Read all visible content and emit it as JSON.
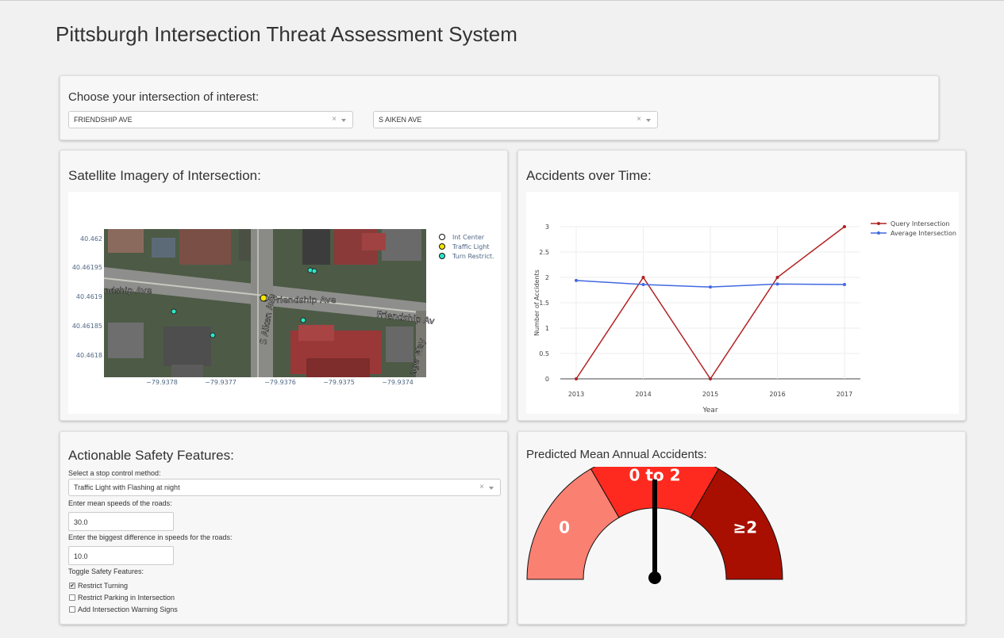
{
  "app": {
    "title": "Pittsburgh Intersection Threat Assessment System"
  },
  "chooser": {
    "title": "Choose your intersection of interest:",
    "street1": "FRIENDSHIP AVE",
    "street2": "S AIKEN AVE",
    "clear_glyph": "×"
  },
  "satellite": {
    "title": "Satellite Imagery of Intersection:",
    "y_ticks": [
      "40.462",
      "40.46195",
      "40.4619",
      "40.46185",
      "40.4618"
    ],
    "x_ticks": [
      "−79.9378",
      "−79.9377",
      "−79.9376",
      "−79.9375",
      "−79.9374"
    ],
    "legend": [
      {
        "label": "Int Center",
        "color": "#ffffff"
      },
      {
        "label": "Traffic Light",
        "color": "#f2e600"
      },
      {
        "label": "Turn Restrict.",
        "color": "#2ee6c8"
      }
    ],
    "street_labels": [
      "ndship Ave",
      "Friendship Ave",
      "S Aiken Ave",
      "Friendship Av",
      "age Way"
    ]
  },
  "accidents": {
    "title": "Accidents over Time:",
    "chart_data": {
      "type": "line",
      "x": [
        2013,
        2014,
        2015,
        2016,
        2017
      ],
      "xlabel": "Year",
      "ylabel": "Number of Accidents",
      "ylim": [
        0,
        3
      ],
      "yticks": [
        "0",
        "0.5",
        "1",
        "1.5",
        "2",
        "2.5",
        "3"
      ],
      "grid": true,
      "legend_position": "top-right",
      "series": [
        {
          "name": "Query Intersection",
          "color": "#b22222",
          "values": [
            0,
            2,
            0,
            2,
            3
          ]
        },
        {
          "name": "Average Intersection",
          "color": "#4169e1",
          "values": [
            1.94,
            1.86,
            1.81,
            1.87,
            1.86
          ]
        }
      ]
    }
  },
  "features": {
    "title": "Actionable Safety Features:",
    "stop_label": "Select a stop control method:",
    "stop_value": "Traffic Light with Flashing at night",
    "speed_label": "Enter mean speeds of the roads:",
    "speed_value": "30.0",
    "diff_label": "Enter the biggest difference in speeds for the roads:",
    "diff_value": "10.0",
    "toggle_label": "Toggle Safety Features:",
    "toggles": [
      {
        "label": "Restrict Turning",
        "checked": true
      },
      {
        "label": "Restrict Parking in Intersection",
        "checked": false
      },
      {
        "label": "Add Intersection Warning Signs",
        "checked": false
      }
    ],
    "check_glyph": "✔"
  },
  "prediction": {
    "title": "Predicted Mean Annual Accidents:",
    "gauge": [
      {
        "label": "0",
        "color": "#fa8072"
      },
      {
        "label": "0 to 2",
        "color": "#ff2a1f"
      },
      {
        "label": "≥2",
        "color": "#a80f00"
      }
    ],
    "needle_fraction": 0.5
  }
}
